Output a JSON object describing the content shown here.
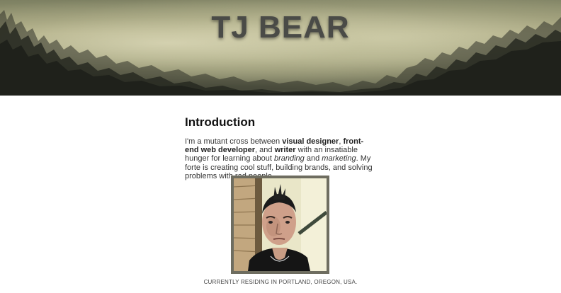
{
  "header": {
    "title": "TJ BEAR"
  },
  "intro": {
    "heading": "Introduction",
    "p1": "I'm a mutant cross between ",
    "b1": "visual designer",
    "p2": ", ",
    "b2": "front-end web developer",
    "p3": ", and ",
    "b3": "writer",
    "p4": " with an insatiable hunger for learning about ",
    "i1": "branding",
    "p5": " and ",
    "i2": "marketing",
    "p6": ". My forte is creating cool stuff, building brands, and solving problems with rad people."
  },
  "profile": {
    "caption": "CURRENTLY RESIDING IN PORTLAND, OREGON, USA."
  }
}
